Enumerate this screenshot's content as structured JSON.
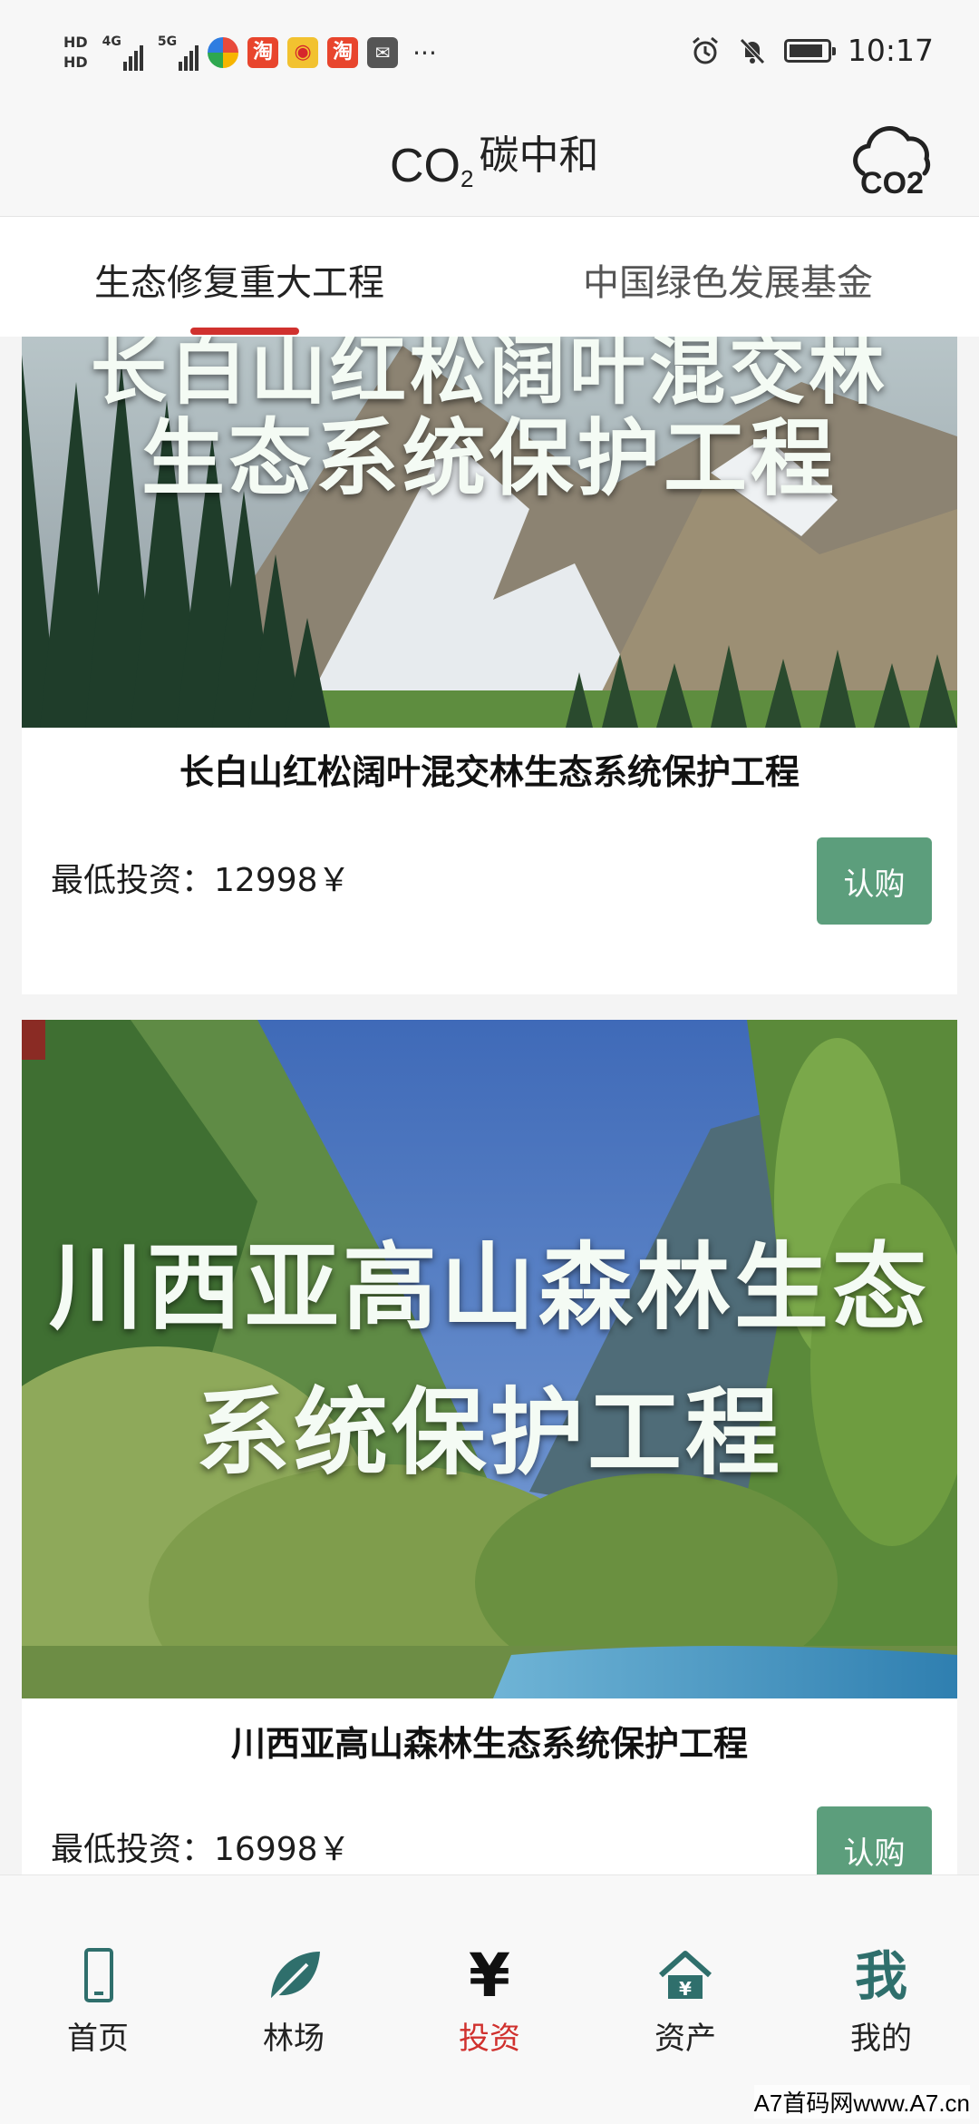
{
  "status_bar": {
    "time": "10:17",
    "hd1": "HD",
    "hd2": "HD",
    "net1": "4G",
    "net2": "5G",
    "more": "···",
    "app_icons": [
      "browser-icon",
      "taobao-icon",
      "weibo-icon",
      "taobao-icon",
      "mail-icon"
    ],
    "app_glyphs": [
      "",
      "淘",
      "",
      "淘",
      ""
    ]
  },
  "header": {
    "logo_co": "CO",
    "logo_sub": "2",
    "title": "碳中和",
    "cloud_text": "CO2"
  },
  "tabs": [
    {
      "label": "生态修复重大工程",
      "active": true
    },
    {
      "label": "中国绿色发展基金",
      "active": false
    }
  ],
  "projects": [
    {
      "banner_lines": [
        "长白山红松阔叶混交林",
        "生态系统保护工程"
      ],
      "title": "长白山红松阔叶混交林生态系统保护工程",
      "price_label": "最低投资：",
      "price": "12998￥",
      "button": "认购"
    },
    {
      "banner_lines": [
        "川西亚高山森林生态",
        "系统保护工程"
      ],
      "title": "川西亚高山森林生态系统保护工程",
      "price_label": "最低投资：",
      "price": "16998￥",
      "button": "认购"
    }
  ],
  "nav": [
    {
      "label": "首页",
      "icon": "phone-icon"
    },
    {
      "label": "林场",
      "icon": "leaf-icon"
    },
    {
      "label": "投资",
      "icon": "yen-icon",
      "glyph": "¥",
      "active": true
    },
    {
      "label": "资产",
      "icon": "house-yen-icon",
      "glyph": "¥"
    },
    {
      "label": "我的",
      "icon": "me-icon",
      "glyph": "我"
    }
  ],
  "watermark": "A7首码网www.A7.cn",
  "colors": {
    "accent_red": "#d0312e",
    "button_green": "#5c9e7c",
    "icon_teal": "#2f6f6c"
  }
}
